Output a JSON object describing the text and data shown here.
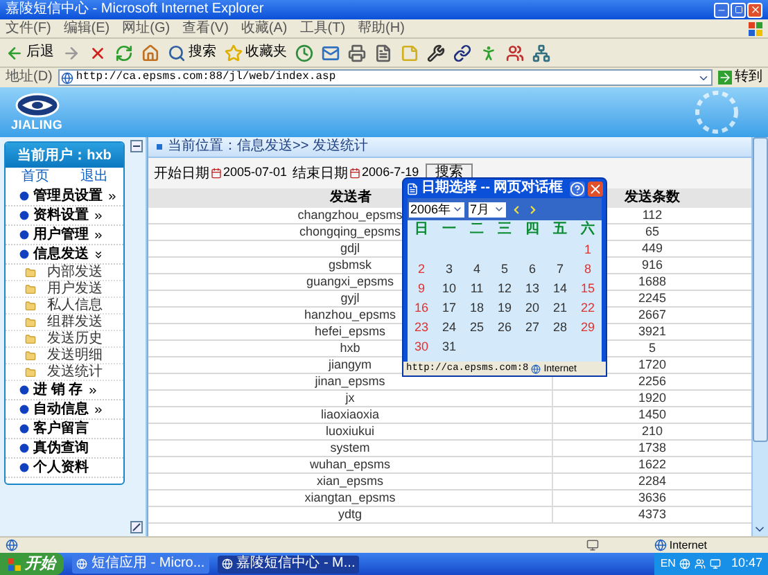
{
  "window": {
    "title": "嘉陵短信中心 - Microsoft Internet Explorer"
  },
  "menu": [
    "文件(F)",
    "编辑(E)",
    "网址(G)",
    "查看(V)",
    "收藏(A)",
    "工具(T)",
    "帮助(H)"
  ],
  "toolbar": [
    {
      "kind": "back",
      "label": "后退"
    },
    {
      "kind": "forward"
    },
    {
      "kind": "stop"
    },
    {
      "kind": "refresh"
    },
    {
      "kind": "home"
    },
    {
      "kind": "search",
      "label": "搜索"
    },
    {
      "kind": "favorites",
      "label": "收藏夹"
    },
    {
      "kind": "history"
    },
    {
      "kind": "mail"
    },
    {
      "kind": "print"
    },
    {
      "kind": "edit"
    },
    {
      "kind": "notes"
    },
    {
      "kind": "tool"
    },
    {
      "kind": "link"
    },
    {
      "kind": "runner"
    },
    {
      "kind": "messenger"
    },
    {
      "kind": "network"
    }
  ],
  "address": {
    "label": "地址(D)",
    "value": "http://ca.epsms.com:88/jl/web/index.asp",
    "go": "转到"
  },
  "banner": {
    "logo_text": "JIALING"
  },
  "sidebar": {
    "user": "当前用户：hxb",
    "links": [
      "首页",
      "退出"
    ],
    "items": [
      {
        "label": "管理员设置",
        "expanded": false
      },
      {
        "label": "资料设置",
        "expanded": false
      },
      {
        "label": "用户管理",
        "expanded": false
      },
      {
        "label": "信息发送",
        "expanded": true,
        "children": [
          {
            "label": "内部发送"
          },
          {
            "label": "用户发送"
          },
          {
            "label": "私人信息"
          },
          {
            "label": "组群发送"
          },
          {
            "label": "发送历史"
          },
          {
            "label": "发送明细"
          },
          {
            "label": "发送统计"
          }
        ]
      },
      {
        "label": "进 销 存",
        "expanded": false
      },
      {
        "label": "自动信息",
        "expanded": false
      },
      {
        "label": "客户留言"
      },
      {
        "label": "真伪查询"
      },
      {
        "label": "个人资料"
      }
    ]
  },
  "breadcrumb": "当前位置：信息发送>> 发送统计",
  "search": {
    "start_label": "开始日期",
    "start": "2005-07-01",
    "end_label": "结束日期",
    "end": "2006-7-19",
    "button": "搜索"
  },
  "table": {
    "columns": [
      "发送者",
      "发送条数"
    ],
    "rows": [
      [
        "changzhou_epsms",
        "112"
      ],
      [
        "chongqing_epsms",
        "65"
      ],
      [
        "gdjl",
        "449"
      ],
      [
        "gsbmsk",
        "916"
      ],
      [
        "guangxi_epsms",
        "1688"
      ],
      [
        "gyjl",
        "2245"
      ],
      [
        "hanzhou_epsms",
        "2667"
      ],
      [
        "hefei_epsms",
        "3921"
      ],
      [
        "hxb",
        "5"
      ],
      [
        "jiangym",
        "1720"
      ],
      [
        "jinan_epsms",
        "2256"
      ],
      [
        "jx",
        "1920"
      ],
      [
        "liaoxiaoxia",
        "1450"
      ],
      [
        "luoxiukui",
        "210"
      ],
      [
        "system",
        "1738"
      ],
      [
        "wuhan_epsms",
        "1622"
      ],
      [
        "xian_epsms",
        "2284"
      ],
      [
        "xiangtan_epsms",
        "3636"
      ],
      [
        "ydtg",
        "4373"
      ]
    ]
  },
  "dialog": {
    "title": "日期选择 -- 网页对话框",
    "year": "2006年",
    "month": "7月",
    "weekdays": [
      "日",
      "一",
      "二",
      "三",
      "四",
      "五",
      "六"
    ],
    "weeks": [
      [
        "1"
      ],
      [
        "2",
        "3",
        "4",
        "5",
        "6",
        "7",
        "8"
      ],
      [
        "9",
        "10",
        "11",
        "12",
        "13",
        "14",
        "15"
      ],
      [
        "16",
        "17",
        "18",
        "19",
        "20",
        "21",
        "22"
      ],
      [
        "23",
        "24",
        "25",
        "26",
        "27",
        "28",
        "29"
      ],
      [
        "30",
        "31"
      ]
    ],
    "status_url": "http://ca.epsms.com:8",
    "status_zone": "Internet"
  },
  "status_bar": {
    "zone": "Internet"
  },
  "taskbar": {
    "start": "开始",
    "tasks": [
      {
        "label": "短信应用 - Micro...",
        "selected": false
      },
      {
        "label": "嘉陵短信中心 - M...",
        "selected": true
      }
    ],
    "language": "EN",
    "time": "10:47"
  }
}
